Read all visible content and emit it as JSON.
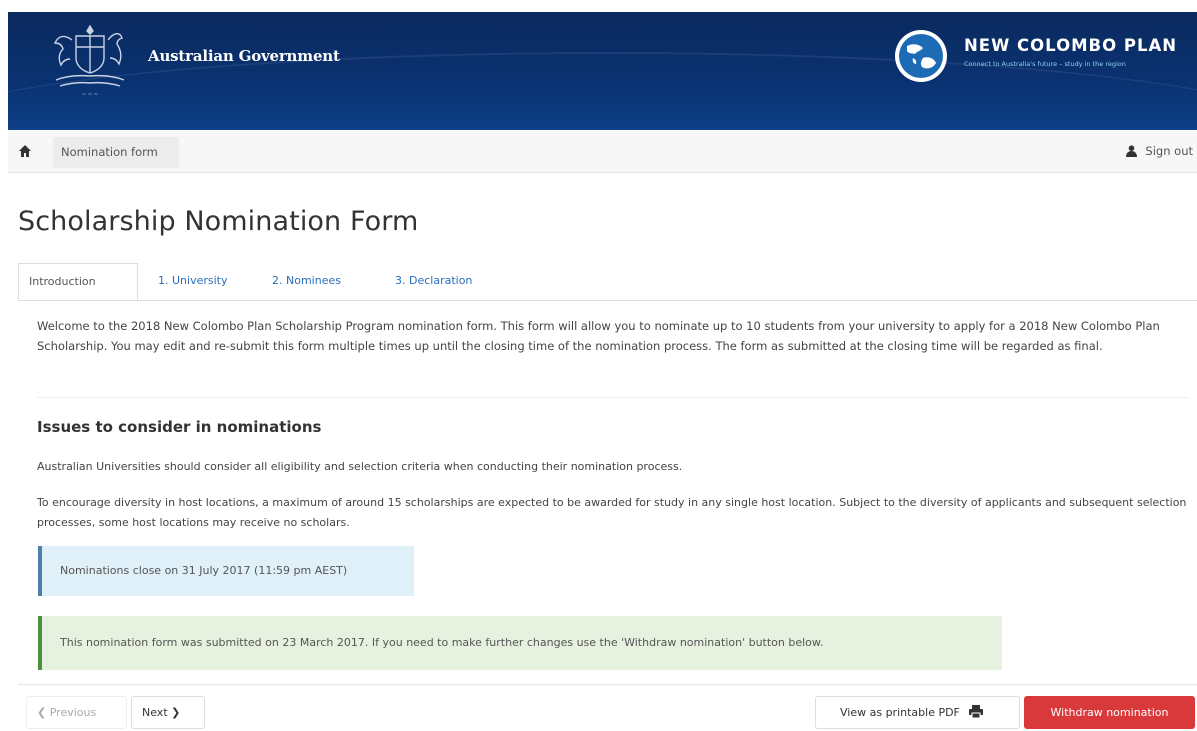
{
  "header": {
    "gov_title": "Australian Government",
    "program_title": "NEW COLOMBO PLAN",
    "program_tagline": "Connect to Australia's future – study in the region"
  },
  "nav": {
    "active_tab": "Nomination form",
    "sign_out": "Sign out"
  },
  "page": {
    "title": "Scholarship Nomination Form"
  },
  "tabs": [
    {
      "label": "Introduction",
      "active": true
    },
    {
      "label": "1. University",
      "active": false
    },
    {
      "label": "2. Nominees",
      "active": false
    },
    {
      "label": "3. Declaration",
      "active": false
    }
  ],
  "intro": {
    "text": "Welcome to the 2018 New Colombo Plan Scholarship Program nomination form. This form will allow you to nominate up to 10 students from your university to apply for a 2018 New Colombo Plan Scholarship. You may edit and re-submit this form multiple times up until the closing time of the nomination process. The form as submitted at the closing time will be regarded as final."
  },
  "issues": {
    "heading": "Issues to consider in nominations",
    "para1": "Australian Universities should consider all eligibility and selection criteria when conducting their nomination process.",
    "para2": "To encourage diversity in host locations, a maximum of around 15 scholarships are expected to be awarded for study in any single host location. Subject to the diversity of applicants and subsequent selection processes, some host locations may receive no scholars."
  },
  "alerts": {
    "info": "Nominations close on 31 July 2017 (11:59 pm AEST)",
    "success": "This nomination form was submitted on 23 March 2017. If you need to make further changes use the 'Withdraw nomination' button below."
  },
  "footer_buttons": {
    "previous": "Previous",
    "next": "Next",
    "pdf": "View as printable PDF",
    "withdraw": "Withdraw nomination"
  },
  "icons": {
    "home": "home-icon",
    "user": "user-icon",
    "prev": "chevron-left-icon",
    "next": "chevron-right-icon",
    "print": "print-icon"
  },
  "colors": {
    "banner": "#0a3170",
    "link": "#2a6ebb",
    "withdraw": "#d9393a",
    "info_bg": "#dff0f8",
    "success_bg": "#e6f2df"
  }
}
